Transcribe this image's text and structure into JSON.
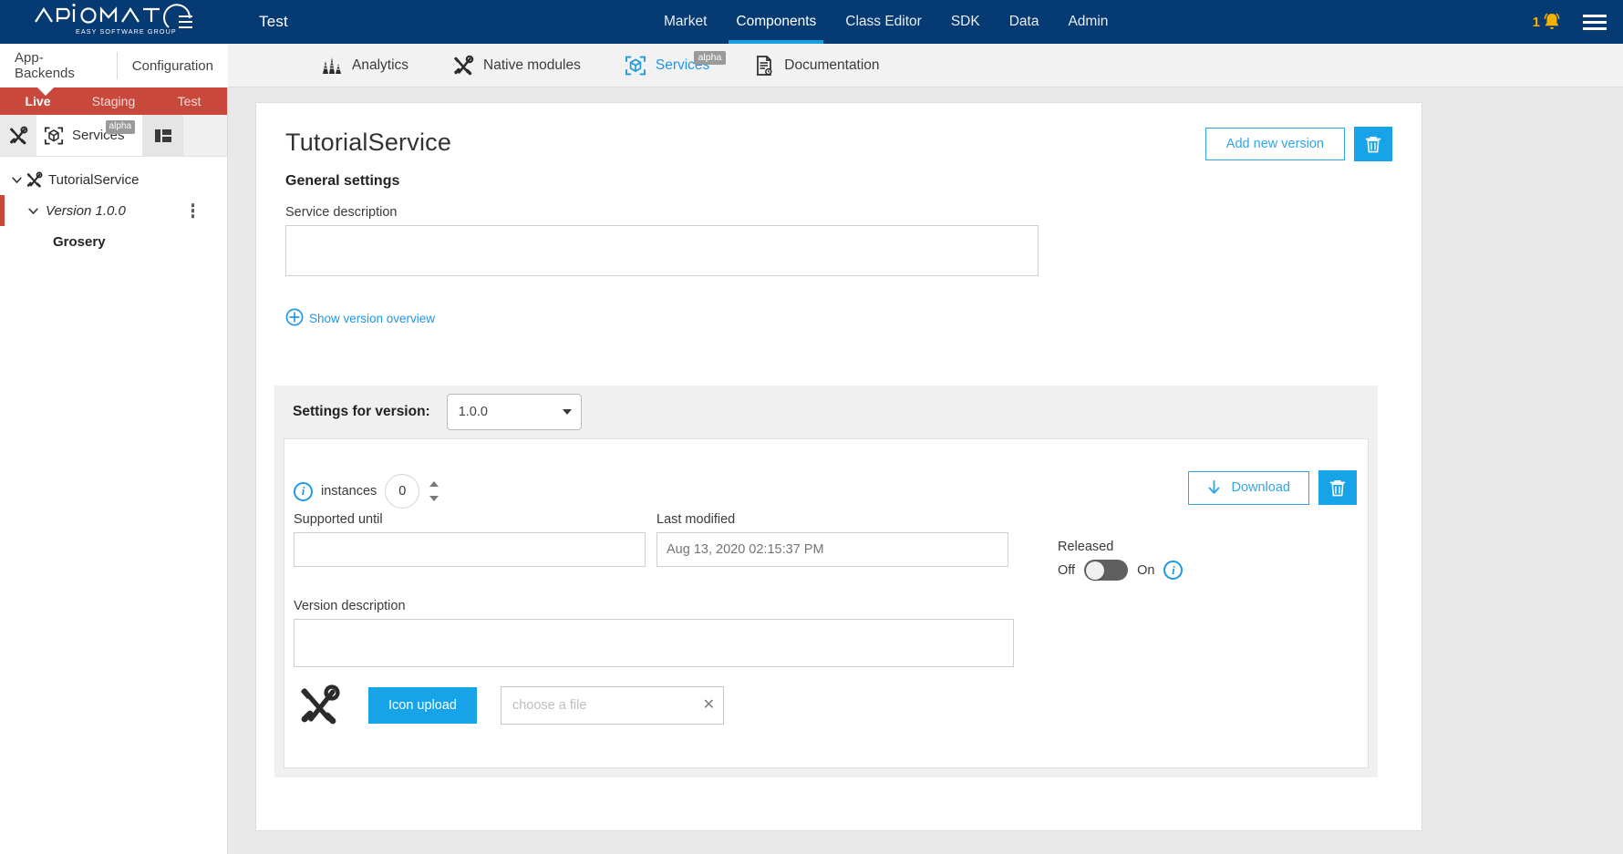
{
  "header": {
    "logo_text": "APIOMAT",
    "logo_sub": "EASY SOFTWARE GROUP",
    "environment_name": "Test",
    "nav": [
      {
        "label": "Market",
        "active": false
      },
      {
        "label": "Components",
        "active": true
      },
      {
        "label": "Class Editor",
        "active": false
      },
      {
        "label": "SDK",
        "active": false
      },
      {
        "label": "Data",
        "active": false
      },
      {
        "label": "Admin",
        "active": false
      }
    ],
    "notification_count": "1",
    "accent_blue": "#18a0e0",
    "header_bg": "#053a72"
  },
  "subnav": {
    "left_items": [
      {
        "label": "App-Backends"
      },
      {
        "label": "Configuration"
      }
    ],
    "tabs": [
      {
        "label": "Analytics",
        "icon": "analytics-icon",
        "badge": "",
        "active": false
      },
      {
        "label": "Native modules",
        "icon": "tools-icon",
        "badge": "",
        "active": false
      },
      {
        "label": "Services",
        "icon": "cube-scan-icon",
        "badge": "alpha",
        "active": true
      },
      {
        "label": "Documentation",
        "icon": "document-icon",
        "badge": "",
        "active": false
      }
    ]
  },
  "sidebar": {
    "environments": [
      {
        "label": "Live",
        "active": true
      },
      {
        "label": "Staging",
        "active": false
      },
      {
        "label": "Test",
        "active": false
      }
    ],
    "env_active_color": "#c9483c",
    "panel_title": "Services",
    "panel_badge": "alpha",
    "tree": {
      "service": "TutorialService",
      "version": "Version 1.0.0",
      "module": "Grosery"
    }
  },
  "main": {
    "title": "TutorialService",
    "section_heading": "General settings",
    "add_version_label": "Add new version",
    "delete_service_icon": "trash-icon",
    "service_description_label": "Service description",
    "service_description_value": "",
    "show_version_overview_label": "Show version overview",
    "version_panel": {
      "settings_label": "Settings for version:",
      "selected_version": "1.0.0",
      "version_options": [
        "1.0.0"
      ],
      "instances_label": "instances",
      "instances_value": "0",
      "download_label": "Download",
      "delete_version_icon": "trash-icon",
      "supported_until_label": "Supported until",
      "supported_until_value": "",
      "last_modified_label": "Last modified",
      "last_modified_placeholder": "Aug 13, 2020 02:15:37 PM",
      "released_label": "Released",
      "released_off_label": "Off",
      "released_on_label": "On",
      "released_state": "off",
      "version_description_label": "Version description",
      "version_description_value": "",
      "icon_upload_label": "Icon upload",
      "file_placeholder": "choose a file",
      "file_value": ""
    }
  },
  "colors": {
    "primary_blue": "#17a3e8",
    "link_blue": "#2196e8",
    "red": "#c9483c",
    "amber": "#f5b200"
  }
}
